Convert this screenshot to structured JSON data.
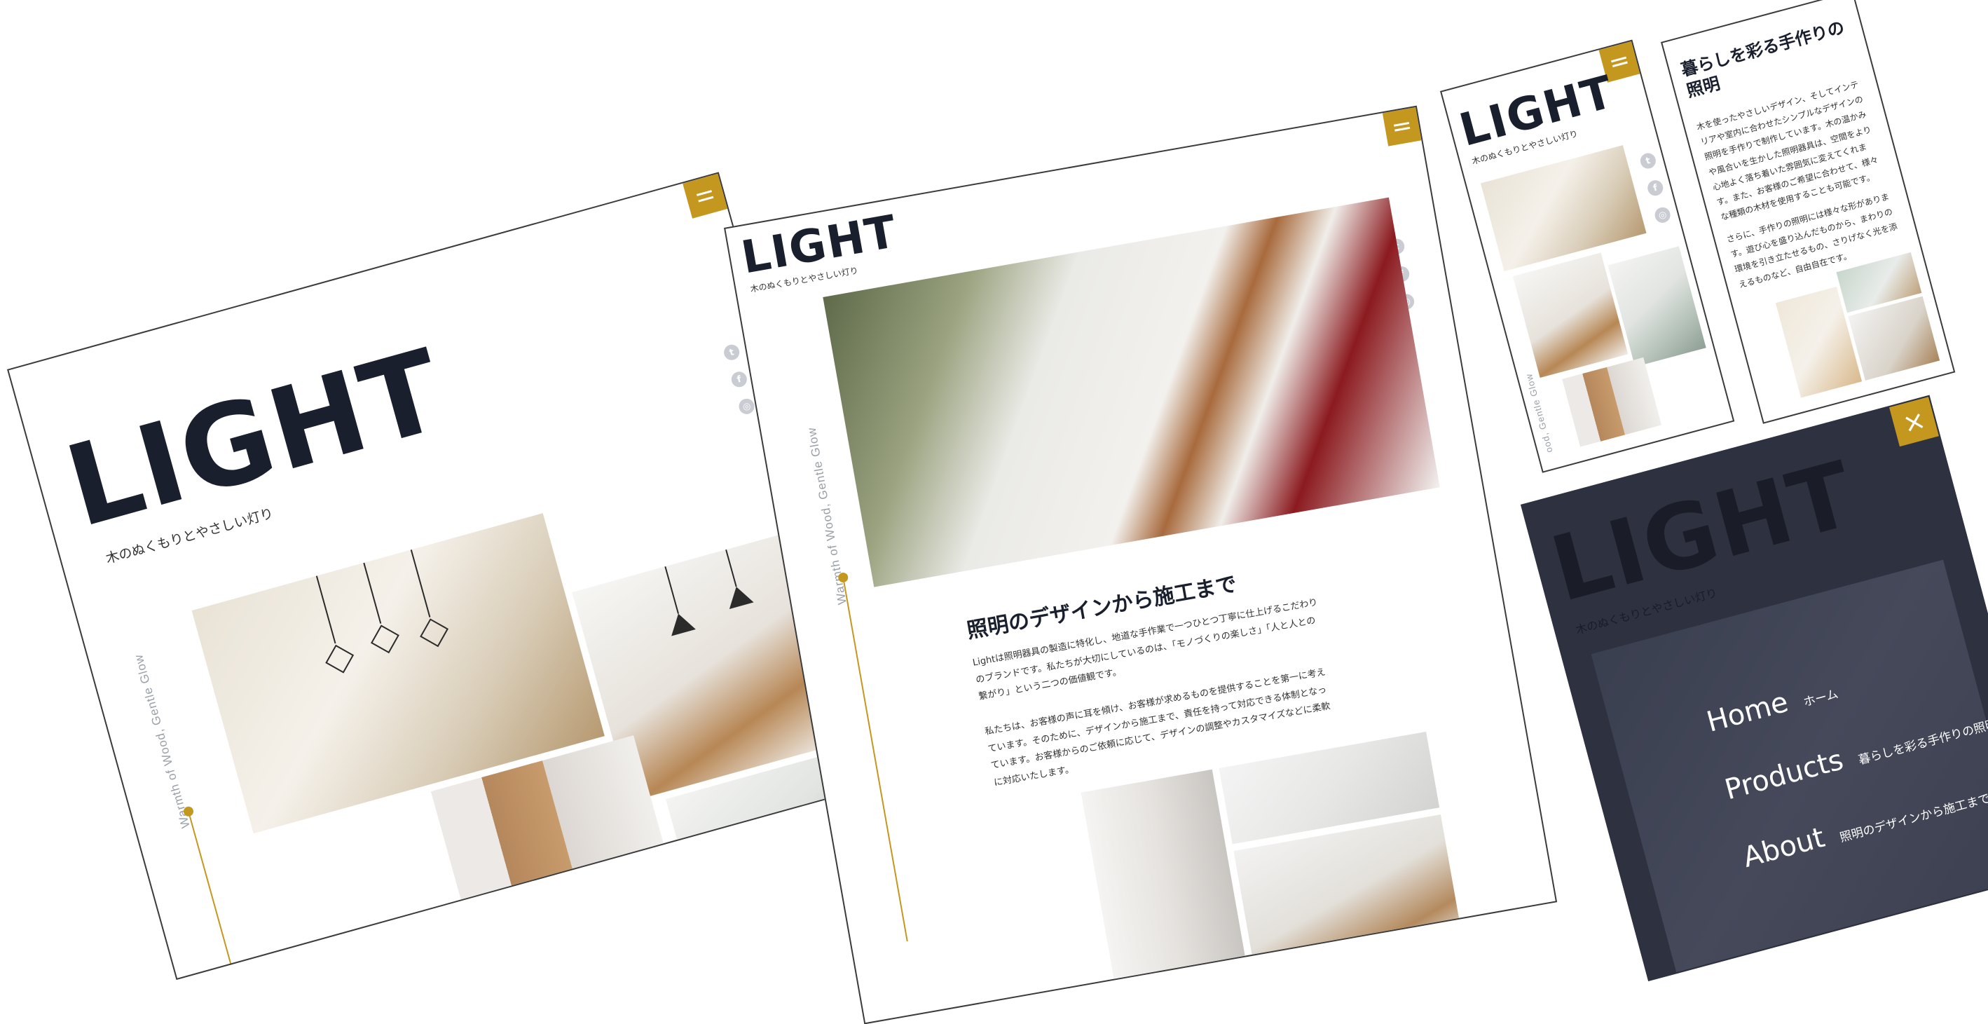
{
  "brand": {
    "logo": "LIGHT",
    "tagline": "木のぬくもりとやさしい灯り",
    "vertical_text": "Warmth of Wood, Gentle Glow",
    "vertical_text_cut": "ood, Gentle Glow",
    "accent_color": "#c4971f",
    "dark_color": "#2e3140"
  },
  "social": [
    "twitter-icon",
    "facebook-icon",
    "instagram-icon"
  ],
  "social_glyphs": {
    "twitter": "t",
    "facebook": "f",
    "instagram": "◎"
  },
  "menu_glyph": "=",
  "close_glyph": "×",
  "section_design": {
    "heading": "照明のデザインから施工まで",
    "para1": "Lightは照明器具の製造に特化し、地道な手作業で一つひとつ丁寧に仕上げるこだわりのブランドです。私たちが大切にしているのは、「モノづくりの楽しさ」「人と人との繋がり」という二つの価値観です。",
    "para2": "私たちは、お客様の声に耳を傾け、お客様が求めるものを提供することを第一に考えています。そのために、デザインから施工まで、責任を持って対応できる体制となっています。お客様からのご依頼に応じて、デザインの調整やカスタマイズなどに柔軟に対応いたします。"
  },
  "section_products": {
    "heading": "暮らしを彩る手作りの照明",
    "para1": "木を使ったやさしいデザイン、そしてインテリアや室内に合わせたシンプルなデザインの照明を手作りで制作しています。木の温かみや風合いを生かした照明器具は、空間をより心地よく落ち着いた雰囲気に変えてくれます。また、お客様のご希望に合わせて、様々な種類の木材を使用することも可能です。",
    "para2": "さらに、手作りの照明には様々な形があります。遊び心を盛り込んだものから、まわりの環境を引き立たせるもの、さりげなく光を添えるものなど、自由自在です。"
  },
  "nav": [
    {
      "en": "Home",
      "jp": "ホーム"
    },
    {
      "en": "Products",
      "jp": "暮らしを彩る手作りの照明"
    },
    {
      "en": "About",
      "jp": "照明のデザインから施工まで"
    }
  ]
}
